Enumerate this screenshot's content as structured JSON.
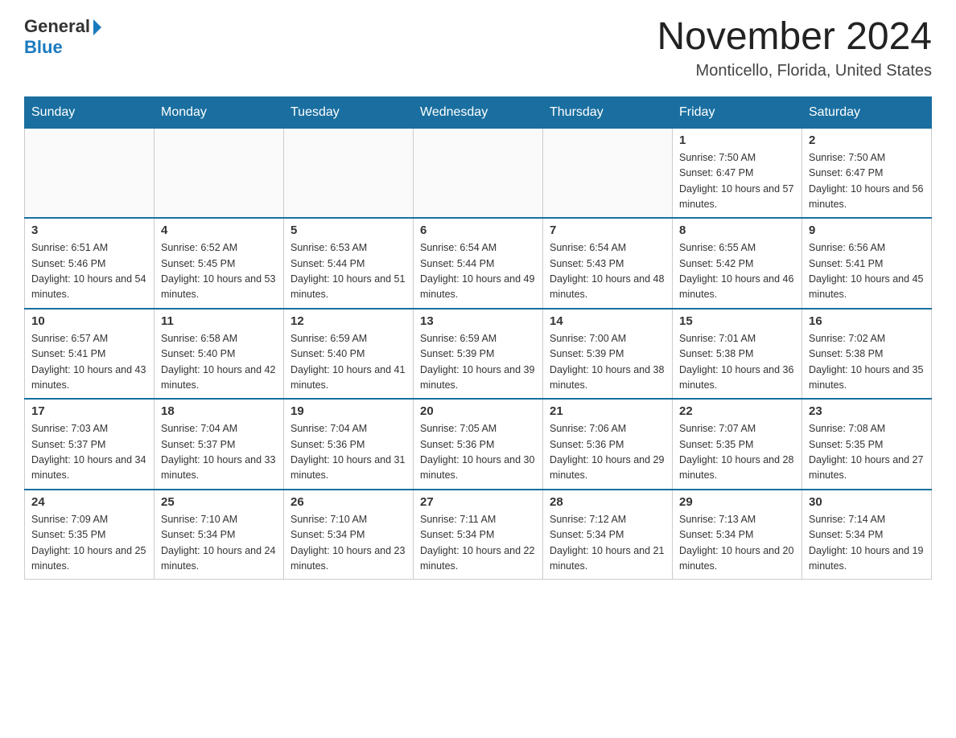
{
  "header": {
    "logo_text": "General",
    "logo_blue": "Blue",
    "title": "November 2024",
    "subtitle": "Monticello, Florida, United States"
  },
  "calendar": {
    "weekdays": [
      "Sunday",
      "Monday",
      "Tuesday",
      "Wednesday",
      "Thursday",
      "Friday",
      "Saturday"
    ],
    "weeks": [
      [
        {
          "day": "",
          "info": ""
        },
        {
          "day": "",
          "info": ""
        },
        {
          "day": "",
          "info": ""
        },
        {
          "day": "",
          "info": ""
        },
        {
          "day": "",
          "info": ""
        },
        {
          "day": "1",
          "info": "Sunrise: 7:50 AM\nSunset: 6:47 PM\nDaylight: 10 hours and 57 minutes."
        },
        {
          "day": "2",
          "info": "Sunrise: 7:50 AM\nSunset: 6:47 PM\nDaylight: 10 hours and 56 minutes."
        }
      ],
      [
        {
          "day": "3",
          "info": "Sunrise: 6:51 AM\nSunset: 5:46 PM\nDaylight: 10 hours and 54 minutes."
        },
        {
          "day": "4",
          "info": "Sunrise: 6:52 AM\nSunset: 5:45 PM\nDaylight: 10 hours and 53 minutes."
        },
        {
          "day": "5",
          "info": "Sunrise: 6:53 AM\nSunset: 5:44 PM\nDaylight: 10 hours and 51 minutes."
        },
        {
          "day": "6",
          "info": "Sunrise: 6:54 AM\nSunset: 5:44 PM\nDaylight: 10 hours and 49 minutes."
        },
        {
          "day": "7",
          "info": "Sunrise: 6:54 AM\nSunset: 5:43 PM\nDaylight: 10 hours and 48 minutes."
        },
        {
          "day": "8",
          "info": "Sunrise: 6:55 AM\nSunset: 5:42 PM\nDaylight: 10 hours and 46 minutes."
        },
        {
          "day": "9",
          "info": "Sunrise: 6:56 AM\nSunset: 5:41 PM\nDaylight: 10 hours and 45 minutes."
        }
      ],
      [
        {
          "day": "10",
          "info": "Sunrise: 6:57 AM\nSunset: 5:41 PM\nDaylight: 10 hours and 43 minutes."
        },
        {
          "day": "11",
          "info": "Sunrise: 6:58 AM\nSunset: 5:40 PM\nDaylight: 10 hours and 42 minutes."
        },
        {
          "day": "12",
          "info": "Sunrise: 6:59 AM\nSunset: 5:40 PM\nDaylight: 10 hours and 41 minutes."
        },
        {
          "day": "13",
          "info": "Sunrise: 6:59 AM\nSunset: 5:39 PM\nDaylight: 10 hours and 39 minutes."
        },
        {
          "day": "14",
          "info": "Sunrise: 7:00 AM\nSunset: 5:39 PM\nDaylight: 10 hours and 38 minutes."
        },
        {
          "day": "15",
          "info": "Sunrise: 7:01 AM\nSunset: 5:38 PM\nDaylight: 10 hours and 36 minutes."
        },
        {
          "day": "16",
          "info": "Sunrise: 7:02 AM\nSunset: 5:38 PM\nDaylight: 10 hours and 35 minutes."
        }
      ],
      [
        {
          "day": "17",
          "info": "Sunrise: 7:03 AM\nSunset: 5:37 PM\nDaylight: 10 hours and 34 minutes."
        },
        {
          "day": "18",
          "info": "Sunrise: 7:04 AM\nSunset: 5:37 PM\nDaylight: 10 hours and 33 minutes."
        },
        {
          "day": "19",
          "info": "Sunrise: 7:04 AM\nSunset: 5:36 PM\nDaylight: 10 hours and 31 minutes."
        },
        {
          "day": "20",
          "info": "Sunrise: 7:05 AM\nSunset: 5:36 PM\nDaylight: 10 hours and 30 minutes."
        },
        {
          "day": "21",
          "info": "Sunrise: 7:06 AM\nSunset: 5:36 PM\nDaylight: 10 hours and 29 minutes."
        },
        {
          "day": "22",
          "info": "Sunrise: 7:07 AM\nSunset: 5:35 PM\nDaylight: 10 hours and 28 minutes."
        },
        {
          "day": "23",
          "info": "Sunrise: 7:08 AM\nSunset: 5:35 PM\nDaylight: 10 hours and 27 minutes."
        }
      ],
      [
        {
          "day": "24",
          "info": "Sunrise: 7:09 AM\nSunset: 5:35 PM\nDaylight: 10 hours and 25 minutes."
        },
        {
          "day": "25",
          "info": "Sunrise: 7:10 AM\nSunset: 5:34 PM\nDaylight: 10 hours and 24 minutes."
        },
        {
          "day": "26",
          "info": "Sunrise: 7:10 AM\nSunset: 5:34 PM\nDaylight: 10 hours and 23 minutes."
        },
        {
          "day": "27",
          "info": "Sunrise: 7:11 AM\nSunset: 5:34 PM\nDaylight: 10 hours and 22 minutes."
        },
        {
          "day": "28",
          "info": "Sunrise: 7:12 AM\nSunset: 5:34 PM\nDaylight: 10 hours and 21 minutes."
        },
        {
          "day": "29",
          "info": "Sunrise: 7:13 AM\nSunset: 5:34 PM\nDaylight: 10 hours and 20 minutes."
        },
        {
          "day": "30",
          "info": "Sunrise: 7:14 AM\nSunset: 5:34 PM\nDaylight: 10 hours and 19 minutes."
        }
      ]
    ]
  }
}
